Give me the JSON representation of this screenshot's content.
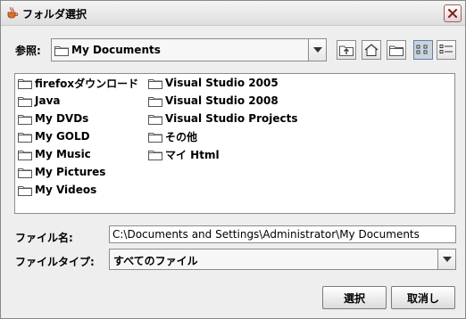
{
  "window": {
    "title": "フォルダ選択"
  },
  "look_in": {
    "label": "参照:",
    "value": "My Documents"
  },
  "toolbar": {
    "icons": [
      "up-folder-icon",
      "home-icon",
      "new-folder-icon",
      "list-view-icon",
      "details-view-icon"
    ],
    "active_view": "list"
  },
  "file_list": {
    "items": [
      {
        "name": "firefoxダウンロード"
      },
      {
        "name": "Java"
      },
      {
        "name": "My DVDs"
      },
      {
        "name": "My GOLD"
      },
      {
        "name": "My Music"
      },
      {
        "name": "My Pictures"
      },
      {
        "name": "My Videos"
      },
      {
        "name": "Visual Studio 2005"
      },
      {
        "name": "Visual Studio 2008"
      },
      {
        "name": "Visual Studio Projects"
      },
      {
        "name": "その他"
      },
      {
        "name": "マイ Html"
      }
    ]
  },
  "file_name": {
    "label": "ファイル名:",
    "value": "C:\\Documents and Settings\\Administrator\\My Documents"
  },
  "file_type": {
    "label": "ファイルタイプ:",
    "value": "すべてのファイル"
  },
  "buttons": {
    "select": "選択",
    "cancel": "取消し"
  }
}
